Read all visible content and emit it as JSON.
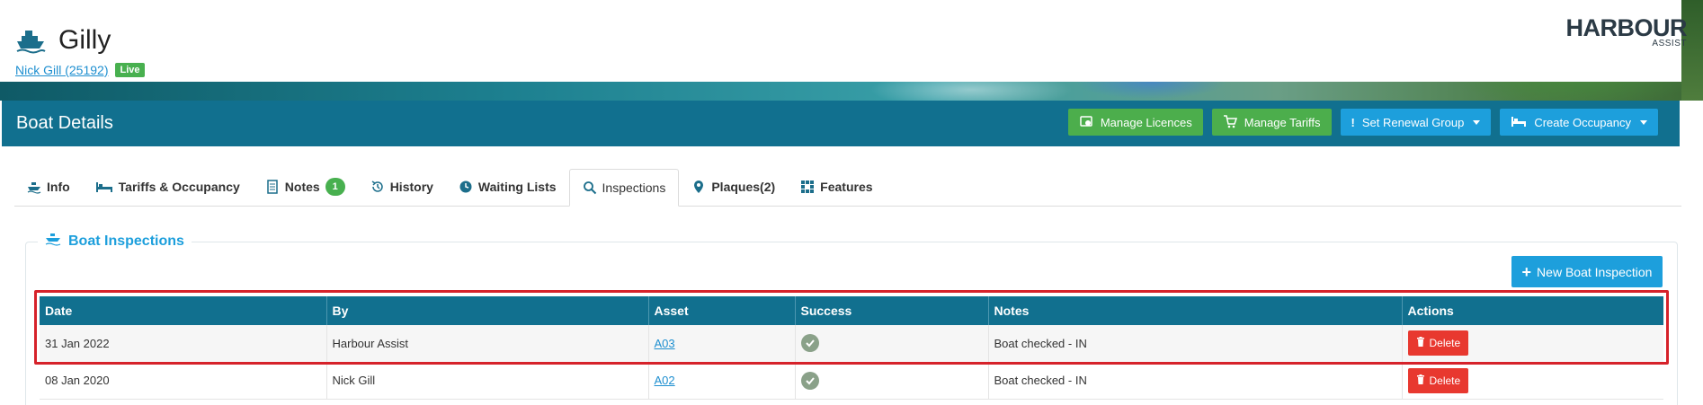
{
  "boat": {
    "name": "Gilly",
    "owner_link": "Nick Gill (25192)",
    "status_badge": "Live"
  },
  "logo": {
    "main": "HARBOUR",
    "sub": "ASSIST"
  },
  "section": {
    "title": "Boat Details",
    "actions": {
      "manage_licences": "Manage Licences",
      "manage_tariffs": "Manage Tariffs",
      "set_renewal_group": "Set Renewal Group",
      "create_occupancy": "Create Occupancy"
    }
  },
  "tabs": [
    {
      "label": "Info",
      "icon": "boat-icon"
    },
    {
      "label": "Tariffs & Occupancy",
      "icon": "bed-icon"
    },
    {
      "label": "Notes",
      "icon": "note-icon",
      "badge": "1"
    },
    {
      "label": "History",
      "icon": "history-icon"
    },
    {
      "label": "Waiting Lists",
      "icon": "clock-icon"
    },
    {
      "label": "Inspections",
      "icon": "search-icon",
      "active": true
    },
    {
      "label": "Plaques(2)",
      "icon": "plaque-icon"
    },
    {
      "label": "Features",
      "icon": "grid-icon"
    }
  ],
  "inspections": {
    "panel_title": "Boat Inspections",
    "new_button": "New Boat Inspection",
    "columns": [
      "Date",
      "By",
      "Asset",
      "Success",
      "Notes",
      "Actions"
    ],
    "rows": [
      {
        "date": "31 Jan 2022",
        "by": "Harbour Assist",
        "asset": "A03",
        "notes": "Boat checked - IN",
        "action": "Delete"
      },
      {
        "date": "08 Jan 2020",
        "by": "Nick Gill",
        "asset": "A02",
        "notes": "Boat checked - IN",
        "action": "Delete"
      }
    ]
  },
  "colors": {
    "header_bg": "#11708f",
    "accent_blue": "#1d9fdc",
    "green": "#4cae4c",
    "danger": "#e8382f",
    "highlight": "#d6222a"
  }
}
